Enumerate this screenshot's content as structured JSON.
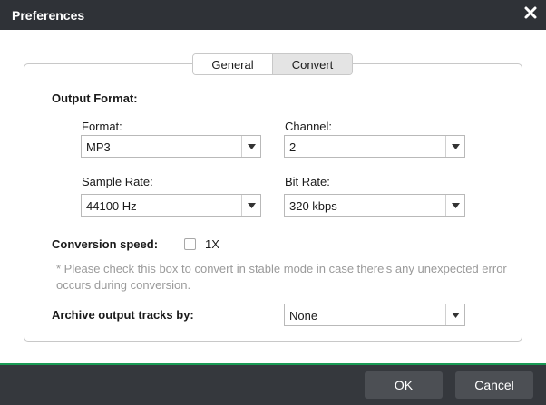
{
  "window": {
    "title": "Preferences",
    "close_icon": "close-icon"
  },
  "tabs": [
    {
      "label": "General",
      "active": false
    },
    {
      "label": "Convert",
      "active": true
    }
  ],
  "output_format": {
    "heading": "Output Format:",
    "format": {
      "label": "Format:",
      "value": "MP3"
    },
    "channel": {
      "label": "Channel:",
      "value": "2"
    },
    "sample_rate": {
      "label": "Sample Rate:",
      "value": "44100 Hz"
    },
    "bit_rate": {
      "label": "Bit Rate:",
      "value": "320 kbps"
    }
  },
  "conversion_speed": {
    "label": "Conversion speed:",
    "option_label": "1X",
    "checked": false,
    "note": "* Please check this box to convert in stable mode in case there's any unexpected error occurs during conversion."
  },
  "archive": {
    "label": "Archive output tracks by:",
    "value": "None"
  },
  "footer": {
    "ok_label": "OK",
    "cancel_label": "Cancel"
  },
  "colors": {
    "titlebar": "#2f3237",
    "footer": "#35383d",
    "footer_accent": "#1a9b55",
    "button": "#4c4f54"
  }
}
